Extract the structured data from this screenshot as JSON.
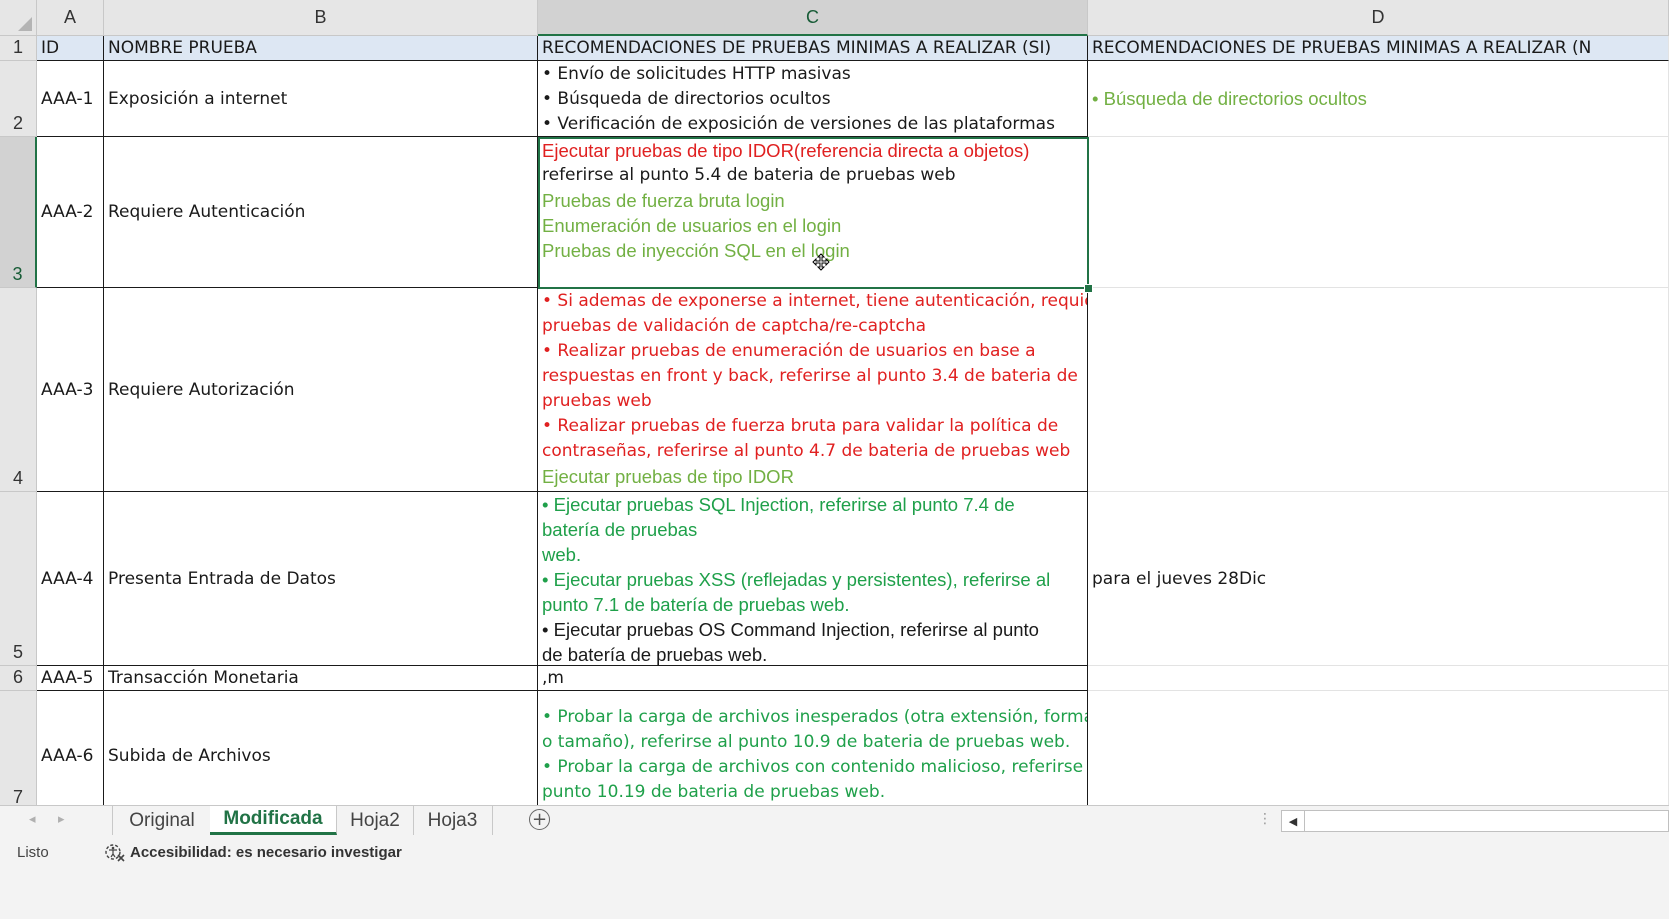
{
  "columns": [
    "A",
    "B",
    "C",
    "D"
  ],
  "rows": [
    "1",
    "2",
    "3",
    "4",
    "5",
    "6",
    "7"
  ],
  "header_row": {
    "a": "ID",
    "b": "NOMBRE PRUEBA",
    "c": "RECOMENDACIONES DE PRUEBAS MINIMAS A REALIZAR (SI)",
    "d": "RECOMENDACIONES DE PRUEBAS MINIMAS A REALIZAR (N"
  },
  "data_rows": [
    {
      "id": "AAA-1",
      "name": "Exposición a internet",
      "c_lines": [
        "• Envío de solicitudes HTTP masivas",
        "• Búsqueda de directorios ocultos",
        "• Verificación de exposición de versiones de las plataformas"
      ],
      "d": "• Búsqueda de directorios ocultos"
    },
    {
      "id": "AAA-2",
      "name": "Requiere Autenticación",
      "c_lines": [
        "Ejecutar pruebas de tipo IDOR(referencia directa a objetos)",
        "referirse al punto 5.4 de bateria de pruebas web",
        "Pruebas de fuerza bruta login",
        "Enumeración de usuarios en el login",
        "Pruebas de inyección SQL en el login"
      ],
      "d": ""
    },
    {
      "id": "AAA-3",
      "name": "Requiere Autorización",
      "c_lines": [
        "• Si ademas de exponerse a internet, tiene autenticación, requiere",
        "pruebas de validación de captcha/re-captcha",
        "• Realizar pruebas de enumeración de usuarios en base a",
        "respuestas en front y back, referirse al punto 3.4 de bateria de",
        "pruebas web",
        "• Realizar pruebas de fuerza bruta para validar la política de",
        "contraseñas, referirse al punto 4.7 de bateria de pruebas web",
        "Ejecutar pruebas de tipo IDOR"
      ],
      "d": ""
    },
    {
      "id": "AAA-4",
      "name": "Presenta Entrada de Datos",
      "c_lines": [
        "• Ejecutar pruebas SQL Injection, referirse al punto 7.4 de",
        "batería de pruebas",
        "web.",
        "• Ejecutar pruebas XSS (reflejadas y persistentes), referirse al",
        "punto 7.1 de batería de pruebas web.",
        "• Ejecutar pruebas OS Command Injection, referirse al punto",
        "de batería de pruebas web."
      ],
      "d": "para el jueves 28Dic"
    },
    {
      "id": "AAA-5",
      "name": "Transacción Monetaria",
      "c_lines": [
        ",m"
      ],
      "d": ""
    },
    {
      "id": "AAA-6",
      "name": "Subida de Archivos",
      "c_lines": [
        "• Probar la carga de archivos inesperados (otra extensión, formato,",
        "o tamaño), referirse al punto 10.9 de bateria de pruebas web.",
        "• Probar la carga de archivos con contenido malicioso, referirse al",
        "punto 10.19 de bateria de pruebas web."
      ],
      "d": ""
    }
  ],
  "sheet_tabs": [
    "Original",
    "Modificada",
    "Hoja2",
    "Hoja3"
  ],
  "active_tab": "Modificada",
  "status": {
    "ready": "Listo",
    "accessibility": "Accesibilidad: es necesario investigar"
  },
  "colors": {
    "header_fill": "#dde7f3",
    "selection": "#217346",
    "red_text": "#e02020",
    "light_green_text": "#72b043",
    "green_text": "#1fa04a"
  },
  "icons": [
    "select-all-triangle",
    "move-cursor-icon",
    "add-sheet-icon",
    "accessibility-icon",
    "scroll-left-icon"
  ]
}
